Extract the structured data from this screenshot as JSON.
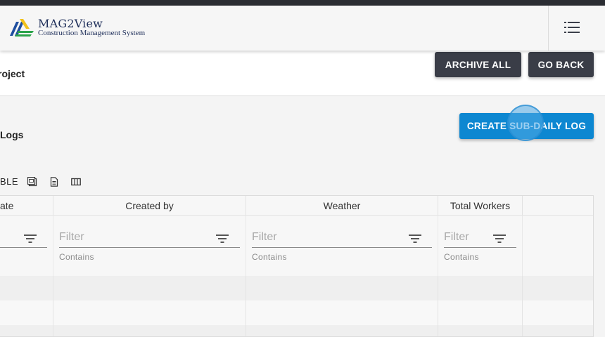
{
  "header": {
    "brand_title": "MAG2View",
    "brand_subtitle": "Construction Management System",
    "icons": {
      "logo": "mag2view-logo",
      "menu": "list-menu-icon"
    }
  },
  "project": {
    "title_partial": "roject"
  },
  "actions": {
    "archive_all": "ARCHIVE ALL",
    "go_back": "GO BACK",
    "create_sub_daily_log": "CREATE SUB-DAILY LOG"
  },
  "section": {
    "title_partial": "Logs"
  },
  "table_toolbar": {
    "label_partial": "BLE",
    "icons": [
      "export-csv-icon",
      "document-icon",
      "columns-icon"
    ]
  },
  "table": {
    "columns": [
      {
        "label": "ate",
        "filter_placeholder": "",
        "filter_hint": ""
      },
      {
        "label": "Created by",
        "filter_placeholder": "Filter",
        "filter_hint": "Contains"
      },
      {
        "label": "Weather",
        "filter_placeholder": "Filter",
        "filter_hint": "Contains"
      },
      {
        "label": "Total Workers",
        "filter_placeholder": "Filter",
        "filter_hint": "Contains"
      }
    ]
  },
  "colors": {
    "dark_button": "#3a3d47",
    "primary_button": "#0d87d1",
    "brand_navy": "#1f2f5a",
    "logo_yellow": "#f2c21b",
    "logo_green": "#2aa34a",
    "logo_blue": "#1f4fa0"
  }
}
